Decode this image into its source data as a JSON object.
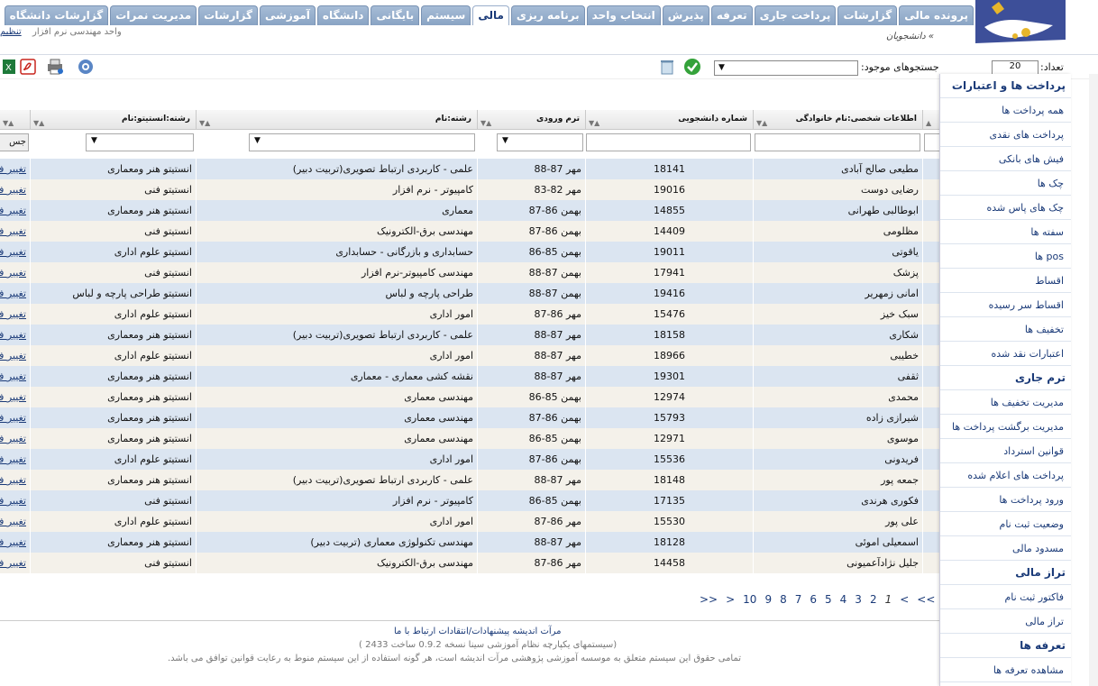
{
  "tabs": [
    "پرونده مالی",
    "گزارشات",
    "پرداخت جاری",
    "تعرفه",
    "پذیرش",
    "انتخاب واحد",
    "برنامه ریزی",
    "مالی",
    "سیستم",
    "بایگانی",
    "دانشگاه",
    "آموزشی",
    "گزارشات",
    "مدیریت نمرات",
    "گزارشات دانشگاه"
  ],
  "active_tab": "مالی",
  "header": {
    "unit_text": "واحد مهندسی نرم افزار",
    "org_link": "تنظیم",
    "breadcrumb": "» دانشجویان"
  },
  "toolbar": {
    "search_label": "جستجوهای موجود:",
    "count_label": "تعداد:",
    "page_size": "20"
  },
  "columns": [
    "اطلاعات شخصی:نام خانوادگی",
    "شماره دانشجویی",
    "ترم ورودی",
    "رشته:نام",
    "رشته:انستیتو:نام"
  ],
  "filter_button": "جس",
  "rows": [
    [
      "مطیعی صالح آبادی",
      "18141",
      "مهر 87-88",
      "علمی - کاربردی ارتباط تصویری(تربیت دبیر)",
      "انستیتو هنر ومعماری",
      "تغییر فا"
    ],
    [
      "رضایی دوست",
      "19016",
      "مهر 82-83",
      "کامپیوتر - نرم افزار",
      "انستیتو فنی",
      "تغییر فا"
    ],
    [
      "ابوطالبی طهرانی",
      "14855",
      "بهمن 86-87",
      "معماری",
      "انستیتو هنر ومعماری",
      "تغییر فا"
    ],
    [
      "مظلومی",
      "14409",
      "بهمن 86-87",
      "مهندسی برق-الکترونیک",
      "انستیتو فنی",
      "تغییر فا"
    ],
    [
      "یاقوتی",
      "19011",
      "بهمن 85-86",
      "حسابداری و بازرگانی - حسابداری",
      "انستیتو علوم اداری",
      "تغییر فا"
    ],
    [
      "پزشک",
      "17941",
      "بهمن 87-88",
      "مهندسی کامپیوتر-نرم افزار",
      "انستیتو فنی",
      "تغییر فا"
    ],
    [
      "امانی زمهریر",
      "19416",
      "بهمن 87-88",
      "طراحی پارچه و لباس",
      "انستیتو طراحی پارچه و لباس",
      "تغییر فا"
    ],
    [
      "سبک خیز",
      "15476",
      "مهر 86-87",
      "امور اداری",
      "انستیتو علوم اداری",
      "تغییر فا"
    ],
    [
      "شکاری",
      "18158",
      "مهر 87-88",
      "علمی - کاربردی ارتباط تصویری(تربیت دبیر)",
      "انستیتو هنر ومعماری",
      "تغییر فا"
    ],
    [
      "خطیبی",
      "18966",
      "مهر 87-88",
      "امور اداری",
      "انستیتو علوم اداری",
      "تغییر فا"
    ],
    [
      "ثقفی",
      "19301",
      "مهر 87-88",
      "نقشه کشی معماری - معماری",
      "انستیتو هنر ومعماری",
      "تغییر فا"
    ],
    [
      "محمدی",
      "12974",
      "بهمن 85-86",
      "مهندسی معماری",
      "انستیتو هنر ومعماری",
      "تغییر فا"
    ],
    [
      "شیرازی زاده",
      "15793",
      "بهمن 86-87",
      "مهندسی معماری",
      "انستیتو هنر ومعماری",
      "تغییر فا"
    ],
    [
      "موسوی",
      "12971",
      "بهمن 85-86",
      "مهندسی معماری",
      "انستیتو هنر ومعماری",
      "تغییر فا"
    ],
    [
      "فریدونی",
      "15536",
      "بهمن 86-87",
      "امور اداری",
      "انستیتو علوم اداری",
      "تغییر فا"
    ],
    [
      "جمعه پور",
      "18148",
      "مهر 87-88",
      "علمی - کاربردی ارتباط تصویری(تربیت دبیر)",
      "انستیتو هنر ومعماری",
      "تغییر فا"
    ],
    [
      "فکوری هرندی",
      "17135",
      "بهمن 85-86",
      "کامپیوتر - نرم افزار",
      "انستیتو فنی",
      "تغییر فا"
    ],
    [
      "علی پور",
      "15530",
      "مهر 86-87",
      "امور اداری",
      "انستیتو علوم اداری",
      "تغییر فا"
    ],
    [
      "اسمعیلی اموئی",
      "18128",
      "مهر 87-88",
      "مهندسی تکنولوژی معماری (تربیت دبیر)",
      "انستیتو هنر ومعماری",
      "تغییر فا"
    ],
    [
      "جلیل نژادآعمیونی",
      "14458",
      "مهر 86-87",
      "مهندسی برق-الکترونیک",
      "انستیتو فنی",
      "تغییر فا"
    ]
  ],
  "pager": [
    "<<",
    "<",
    "1",
    "2",
    "3",
    "4",
    "5",
    "6",
    "7",
    "8",
    "9",
    "10",
    ">",
    ">>"
  ],
  "footer": {
    "link": "مرآت اندیشه پیشنهادات/انتقادات ارتباط با ما",
    "version": "(سیستمهای یکپارچه نظام آموزشی سینا نسخه 0.9.2 ساخت 2433 )",
    "copyright": "تمامی حقوق این سیستم متعلق به موسسه آموزشی پژوهشی مرآت اندیشه است، هر گونه استفاده از این سیستم منوط به رعایت قوانین توافق می باشد."
  },
  "sidebar": [
    {
      "type": "head",
      "label": "پرداخت ها و اعتبارات"
    },
    {
      "type": "item",
      "label": "همه پرداخت ها"
    },
    {
      "type": "item",
      "label": "پرداخت های نقدی"
    },
    {
      "type": "item",
      "label": "فیش های بانکی"
    },
    {
      "type": "item",
      "label": "چک ها"
    },
    {
      "type": "item",
      "label": "چک های پاس شده"
    },
    {
      "type": "item",
      "label": "سفته ها"
    },
    {
      "type": "item",
      "label": "pos ها"
    },
    {
      "type": "item",
      "label": "اقساط"
    },
    {
      "type": "item",
      "label": "اقساط سر رسیده"
    },
    {
      "type": "item",
      "label": "تخفیف ها"
    },
    {
      "type": "item",
      "label": "اعتبارات نقد شده"
    },
    {
      "type": "head",
      "label": "ترم جاری"
    },
    {
      "type": "item",
      "label": "مدیریت تخفیف ها"
    },
    {
      "type": "item",
      "label": "مدیریت برگشت پرداخت ها"
    },
    {
      "type": "item",
      "label": "قوانین استرداد"
    },
    {
      "type": "item",
      "label": "پرداخت های اعلام شده"
    },
    {
      "type": "item",
      "label": "ورود پرداخت ها"
    },
    {
      "type": "item",
      "label": "وضعیت ثبت نام"
    },
    {
      "type": "item",
      "label": "مسدود مالی"
    },
    {
      "type": "head",
      "label": "تراز مالی"
    },
    {
      "type": "item",
      "label": "فاکتور ثبت نام"
    },
    {
      "type": "item",
      "label": "تراز مالی"
    },
    {
      "type": "head",
      "label": "تعرفه ها"
    },
    {
      "type": "item",
      "label": "مشاهده تعرفه ها"
    }
  ],
  "icons": {
    "excel": "excel-icon",
    "pdf": "pdf-icon",
    "print": "print-icon",
    "settings": "gear-icon",
    "delete": "trash-icon",
    "confirm": "check-icon"
  },
  "colors": {
    "brand": "#1a3a78",
    "tab": "#8aa4c4",
    "row_odd": "#dbe5f1",
    "row_even": "#f4f1ea"
  }
}
